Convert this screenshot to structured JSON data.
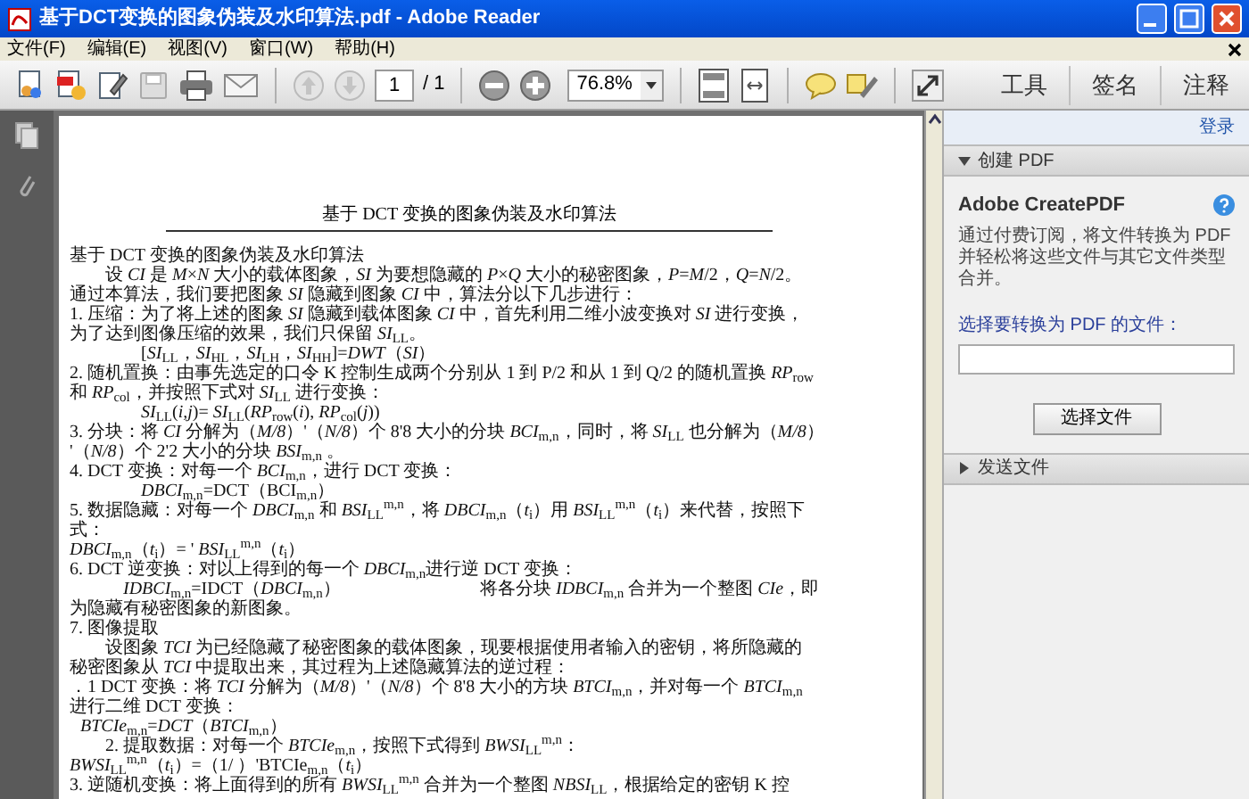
{
  "window": {
    "title": "基于DCT变换的图象伪装及水印算法.pdf - Adobe Reader"
  },
  "menu": [
    "文件(F)",
    "编辑(E)",
    "视图(V)",
    "窗口(W)",
    "帮助(H)"
  ],
  "toolbar": {
    "page_field": {
      "value": "1"
    },
    "page_total": "/ 1",
    "zoom": {
      "value": "76.8%"
    },
    "tabs": [
      "工具",
      "签名",
      "注释"
    ]
  },
  "document": {
    "header": "基于 DCT 变换的图象伪装及水印算法",
    "lines": [
      {
        "kind": "plain",
        "text": "基于 DCT 变换的图象伪装及水印算法"
      },
      {
        "kind": "para",
        "text": "设 *CI* 是 *M*×*N* 大小的载体图象，*SI* 为要想隐藏的 *P*×*Q* 大小的秘密图象，*P*=*M*/2，*Q*=*N*/2。"
      },
      {
        "kind": "plain",
        "text": "通过本算法，我们要把图象 *SI* 隐藏到图象 *CI* 中，算法分以下几步进行："
      },
      {
        "kind": "plain",
        "text": "1.  压缩：为了将上述的图象 *SI* 隐藏到载体图象 *CI* 中，首先利用二维小波变换对 *SI* 进行变换，"
      },
      {
        "kind": "plain",
        "text": "为了达到图像压缩的效果，我们只保留 *SI*$_{LL}$。"
      },
      {
        "kind": "formula",
        "text": "[*SI*$_{LL}$，*SI*$_{HL}$，*SI*$_{LH}$，*SI*$_{HH}$]=*DWT*（*SI*）"
      },
      {
        "kind": "plain",
        "text": "2. 随机置换：由事先选定的口令 K 控制生成两个分别从 1 到 P/2 和从 1 到 Q/2 的随机置换 *RP*$_{row}$"
      },
      {
        "kind": "plain",
        "text": "和 *RP*$_{col}$，并按照下式对 *SI*$_{LL}$ 进行变换："
      },
      {
        "kind": "formula",
        "text": "*SI*$_{LL}$(*i,j*)= *SI*$_{LL}$(*RP*$_{row}$(*i*), *RP*$_{col}$(*j*))"
      },
      {
        "kind": "plain",
        "text": "3. 分块：将 *CI* 分解为（*M/8*）'（*N/8*）个 8'8 大小的分块 *BCI*$_{m,n}$，同时，将 *SI*$_{LL}$ 也分解为（*M/8*）"
      },
      {
        "kind": "plain",
        "text": "'（*N/8*）个 2'2 大小的分块 *BSI*$_{m,n}$ 。"
      },
      {
        "kind": "plain",
        "text": "4. DCT 变换：对每一个 *BCI*$_{m,n}$，进行 DCT 变换："
      },
      {
        "kind": "formula",
        "text": "*DBCI*$_{m,n}$=DCT（BCI$_{m,n}$）"
      },
      {
        "kind": "plain",
        "text": "5.  数据隐藏：对每一个 *DBCI*$_{m,n}$ 和 *BSI*$_{LL}$$^{m,n}$，将 *DBCI*$_{m,n}$（*t*$_{i}$）用 *BSI*$_{LL}$$^{m,n}$（*t*$_{i}$）来代替，按照下"
      },
      {
        "kind": "plain",
        "text": "式："
      },
      {
        "kind": "plain",
        "text": "*DBCI*$_{m,n}$（*t*$_{i}$）=  ' *BSI*$_{LL}$$^{m,n}$（*t*$_{i}$）"
      },
      {
        "kind": "plain",
        "text": "6.  DCT 逆变换：对以上得到的每一个 *DBCI*$_{m,n}$进行逆 DCT 变换："
      },
      {
        "kind": "formula_note",
        "text": "*IDBCI*$_{m,n}$=IDCT（*DBCI*$_{m,n}$）",
        "note": "将各分块 *IDBCI*$_{m,n}$ 合并为一个整图 *CIe*，即"
      },
      {
        "kind": "plain",
        "text": "为隐藏有秘密图象的新图象。"
      },
      {
        "kind": "plain",
        "text": "7.  图像提取"
      },
      {
        "kind": "para",
        "text": "设图象 *TCI* 为已经隐藏了秘密图象的载体图象，现要根据使用者输入的密钥，将所隐藏的"
      },
      {
        "kind": "plain",
        "text": "秘密图象从 *TCI* 中提取出来，其过程为上述隐藏算法的逆过程："
      },
      {
        "kind": "plain",
        "text": "．1 DCT 变换：将 *TCI* 分解为（*M/8*）'（*N/8*）个 8'8 大小的方块 *BTCI*$_{m,n}$，并对每一个 *BTCI*$_{m,n}$"
      },
      {
        "kind": "plain",
        "text": "进行二维 DCT 变换："
      },
      {
        "kind": "step",
        "text": "*BTCIe*$_{m,n}$=*DCT*（*BTCI*$_{m,n}$）"
      },
      {
        "kind": "para",
        "text": "2. 提取数据：对每一个 *BTCIe*$_{m,n}$，按照下式得到 *BWSI*$_{LL}$$^{m,n}$："
      },
      {
        "kind": "plain",
        "text": "*BWSI*$_{LL}$$^{m,n}$（*t*$_{i}$）=（1/  ）'BTCIe$_{m,n}$（*t*$_{i}$）"
      },
      {
        "kind": "plain",
        "text": "3. 逆随机变换：将上面得到的所有 *BWSI*$_{LL}$$^{m,n}$ 合并为一个整图 *NBSI*$_{LL}$，根据给定的密钥 K 控"
      }
    ]
  },
  "right_panel": {
    "login_link": "登录",
    "sections": [
      {
        "title": "创建 PDF",
        "expanded": true
      },
      {
        "title": "发送文件",
        "expanded": false
      }
    ],
    "create_pdf": {
      "heading": "Adobe CreatePDF",
      "description": "通过付费订阅，将文件转换为 PDF 并轻松将这些文件与其它文件类型合并。",
      "field_label": "选择要转换为 PDF 的文件：",
      "button": "选择文件"
    }
  }
}
